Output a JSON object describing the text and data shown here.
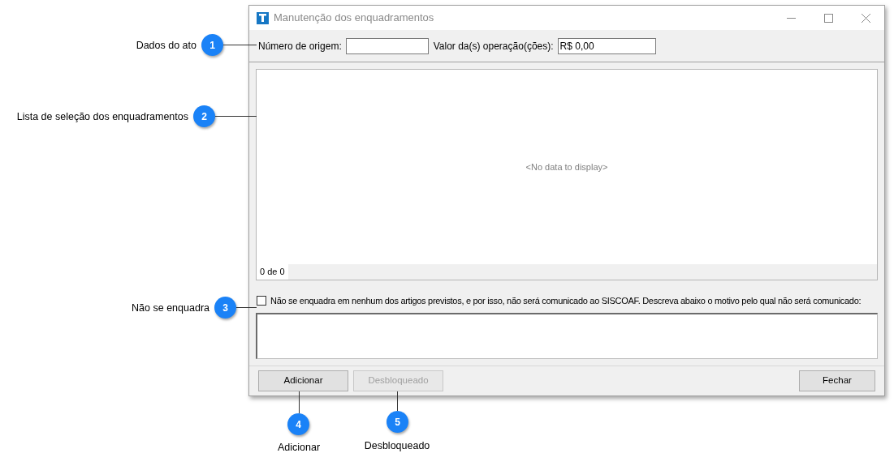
{
  "window": {
    "title": "Manutenção dos enquadramentos"
  },
  "fields": [
    {
      "label": "Número de origem:"
    },
    {
      "label": "Valor da(s) operação(ções):",
      "value": "R$ 0,00"
    }
  ],
  "list": {
    "empty_text": "<No data to display>",
    "footer": "0 de 0"
  },
  "option": {
    "label": "Não se enquadra em nenhum dos artigos previstos, e por isso, não será comunicado ao SISCOAF. Descreva abaixo o motivo pelo qual não será comunicado:",
    "checked": false
  },
  "buttons": [
    {
      "label": "Adicionar",
      "disabled": false
    },
    {
      "label": "Desbloqueado",
      "disabled": true
    },
    {
      "label": "Fechar",
      "disabled": false
    }
  ],
  "callouts": [
    {
      "number": "1",
      "label": "Dados do ato"
    },
    {
      "number": "2",
      "label": "Lista de seleção dos enquadramentos"
    },
    {
      "number": "3",
      "label": "Não se enquadra"
    },
    {
      "number": "4",
      "label": "Adicionar"
    },
    {
      "number": "5",
      "label": "Desbloqueado"
    }
  ]
}
